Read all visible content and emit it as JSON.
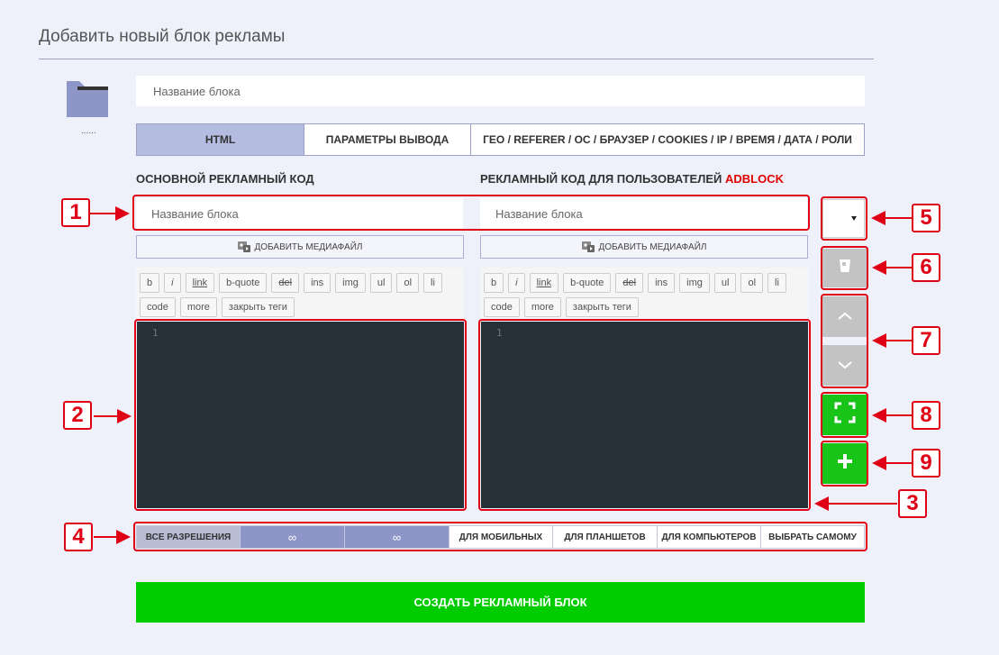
{
  "page": {
    "title": "Добавить новый блок рекламы"
  },
  "folder": {
    "label": "......"
  },
  "block_name": {
    "placeholder": "Название блока"
  },
  "tabs": [
    {
      "label": "HTML",
      "active": true
    },
    {
      "label": "ПАРАМЕТРЫ ВЫВОДА",
      "active": false
    },
    {
      "label": "ГЕО / REFERER / ОС / БРАУЗЕР / COOKIES / IP / ВРЕМЯ / ДАТА / РОЛИ",
      "active": false
    }
  ],
  "main_code": {
    "title": "ОСНОВНОЙ РЕКЛАМНЫЙ КОД",
    "name_placeholder": "Название блока",
    "media_label": "ДОБАВИТЬ МЕДИАФАЙЛ",
    "line_number": "1"
  },
  "adblock_code": {
    "title": "РЕКЛАМНЫЙ КОД ДЛЯ ПОЛЬЗОВАТЕЛЕЙ ",
    "title_highlight": "ADBLOCK",
    "name_placeholder": "Название блока",
    "media_label": "ДОБАВИТЬ МЕДИАФАЙЛ",
    "line_number": "1"
  },
  "quicktags": {
    "row1": [
      "b",
      "i",
      "link",
      "b-quote",
      "del",
      "ins",
      "img",
      "ul",
      "ol",
      "li"
    ],
    "row2": [
      "code",
      "more",
      "закрыть теги"
    ]
  },
  "resolutions": {
    "all": "ВСЕ РАЗРЕШЕНИЯ",
    "min": "∞",
    "max": "∞",
    "mobile": "ДЛЯ МОБИЛЬНЫХ",
    "tablet": "ДЛЯ ПЛАНШЕТОВ",
    "desktop": "ДЛЯ КОМПЬЮТЕРОВ",
    "custom": "ВЫБРАТЬ САМОМУ"
  },
  "create_button": {
    "label": "СОЗДАТЬ РЕКЛАМНЫЙ БЛОК"
  },
  "side_buttons": {
    "select_value": "",
    "icons": [
      "trash-icon",
      "chevron-up-icon",
      "chevron-down-icon",
      "fullscreen-icon",
      "plus-icon"
    ]
  },
  "annotations": [
    "1",
    "2",
    "3",
    "4",
    "5",
    "6",
    "7",
    "8",
    "9"
  ],
  "colors": {
    "accent_green": "#00cc00",
    "annotation_red": "#e00015",
    "editor_bg": "#263039",
    "active_tab": "#b5bce2"
  }
}
